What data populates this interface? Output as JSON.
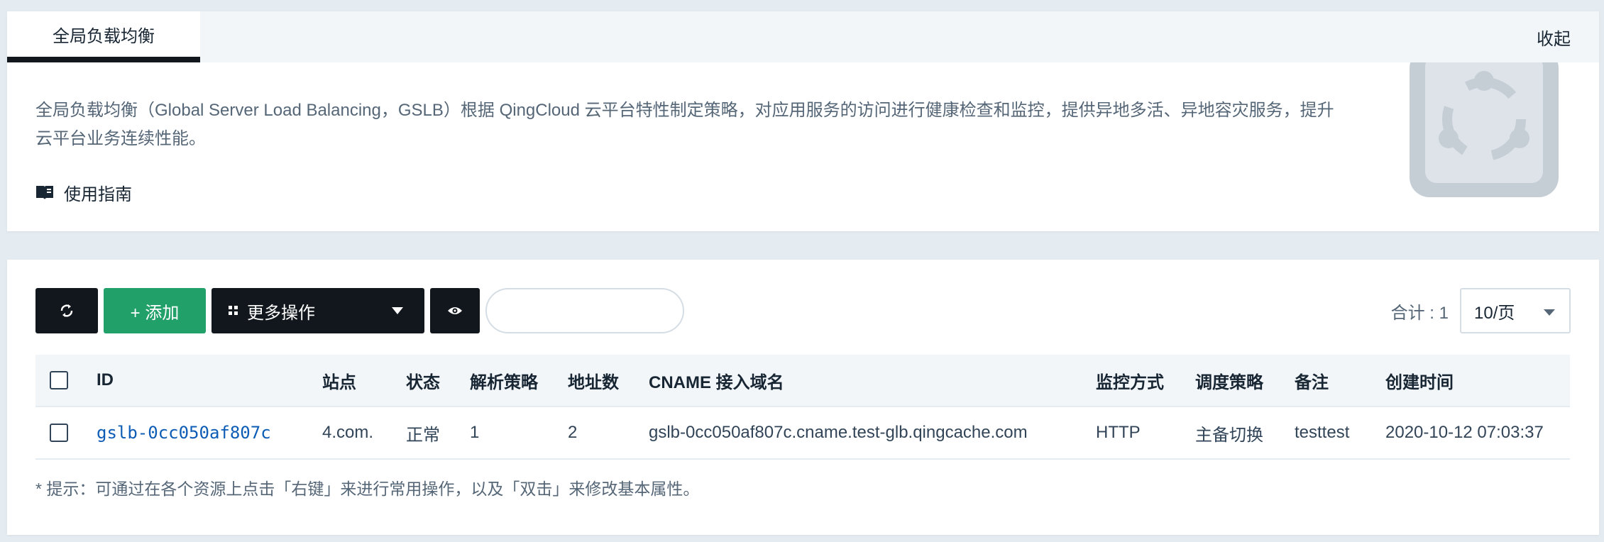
{
  "intro": {
    "tab_label": "全局负载均衡",
    "collapse_label": "收起",
    "description": "全局负载均衡（Global Server Load Balancing，GSLB）根据 QingCloud 云平台特性制定策略，对应用服务的访问进行健康检查和监控，提供异地多活、异地容灾服务，提升云平台业务连续性能。",
    "guide_label": "使用指南",
    "guide_icon": "book-icon"
  },
  "toolbar": {
    "refresh_icon": "refresh-icon",
    "add_label": "+ 添加",
    "more_label": "更多操作",
    "more_icon": "grid-icon",
    "view_icon": "eye-icon",
    "search_placeholder": "",
    "total_label": "合计 : 1",
    "page_size": "10/页"
  },
  "table": {
    "columns": [
      "ID",
      "站点",
      "状态",
      "解析策略",
      "地址数",
      "CNAME 接入域名",
      "监控方式",
      "调度策略",
      "备注",
      "创建时间"
    ],
    "rows": [
      {
        "id": "gslb-0cc050af807c",
        "site": "4.com.",
        "status": "正常",
        "strategy": "1",
        "address_count": "2",
        "cname": "gslb-0cc050af807c.cname.test-glb.qingcache.com",
        "monitor": "HTTP",
        "schedule": "主备切换",
        "note": "testtest",
        "created": "2020-10-12 07:03:37"
      }
    ]
  },
  "tip": "* 提示：可通过在各个资源上点击「右键」来进行常用操作，以及「双击」来修改基本属性。",
  "colors": {
    "dark_button": "#12171d",
    "add_button": "#21a06a",
    "link": "#0d5cb5",
    "page_bg": "#e4ebf1"
  }
}
